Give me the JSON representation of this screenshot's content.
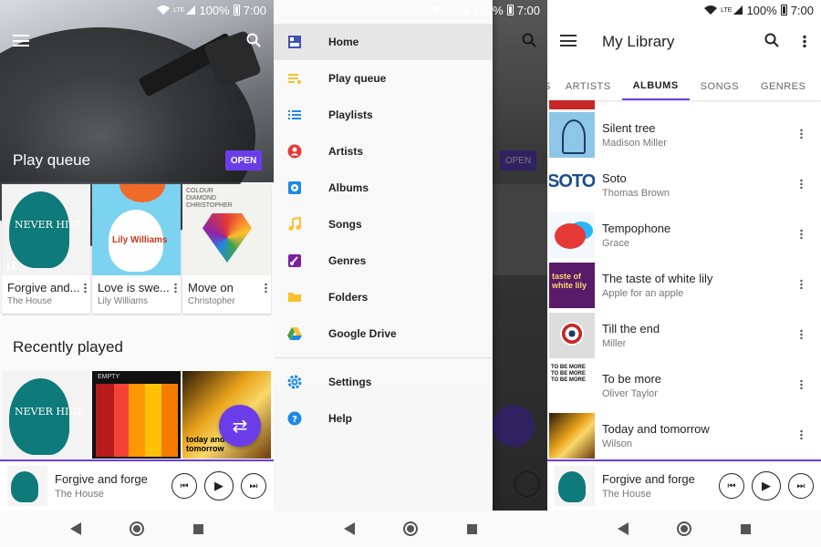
{
  "status": {
    "battery": "100%",
    "time": "7:00",
    "network": "LTE"
  },
  "home": {
    "hero_title": "Play queue",
    "open_label": "OPEN",
    "queue_cards": [
      {
        "title": "Forgive and...",
        "artist": "The House",
        "art_text": "NEVER HIDE"
      },
      {
        "title": "Love is swe...",
        "artist": "Lily Williams",
        "art_text": "Lily Williams"
      },
      {
        "title": "Move on",
        "artist": "Christopher",
        "art_text": "COLOUR DIAMOND CHRISTOPHER"
      }
    ],
    "recent_title": "Recently played",
    "recent_tiles": [
      {
        "art_text": "NEVER HIDE"
      },
      {
        "art_text": "EMPTY"
      },
      {
        "art_text": "today and tomorrow"
      }
    ]
  },
  "drawer": {
    "items": [
      {
        "label": "Home",
        "icon": "home-icon",
        "color": "#3f51b5",
        "active": true
      },
      {
        "label": "Play queue",
        "icon": "queue-icon",
        "color": "#fbc02d"
      },
      {
        "label": "Playlists",
        "icon": "playlist-icon",
        "color": "#1e88e5"
      },
      {
        "label": "Artists",
        "icon": "artist-icon",
        "color": "#e53935"
      },
      {
        "label": "Albums",
        "icon": "album-icon",
        "color": "#1e88e5"
      },
      {
        "label": "Songs",
        "icon": "song-icon",
        "color": "#fbc02d"
      },
      {
        "label": "Genres",
        "icon": "genre-icon",
        "color": "#7b1fa2"
      },
      {
        "label": "Folders",
        "icon": "folder-icon",
        "color": "#fbc02d"
      },
      {
        "label": "Google Drive",
        "icon": "drive-icon",
        "color": "#43a047"
      },
      {
        "label": "Settings",
        "icon": "settings-icon",
        "color": "#1e88e5"
      },
      {
        "label": "Help",
        "icon": "help-icon",
        "color": "#1e88e5"
      }
    ]
  },
  "library": {
    "title": "My Library",
    "tabs": [
      "S",
      "ARTISTS",
      "ALBUMS",
      "SONGS",
      "GENRES"
    ],
    "active_tab": "ALBUMS",
    "albums": [
      {
        "title": "Silent tree",
        "artist": "Madison Miller"
      },
      {
        "title": "Soto",
        "artist": "Thomas Brown"
      },
      {
        "title": "Tempophone",
        "artist": "Grace"
      },
      {
        "title": "The taste of white lily",
        "artist": "Apple for an apple"
      },
      {
        "title": "Till the end",
        "artist": "Miller"
      },
      {
        "title": "To be more",
        "artist": "Oliver Taylor"
      },
      {
        "title": "Today and tomorrow",
        "artist": "Wilson"
      }
    ]
  },
  "player": {
    "title": "Forgive and forge",
    "artist": "The House"
  },
  "colors": {
    "accent": "#6a3de8"
  }
}
